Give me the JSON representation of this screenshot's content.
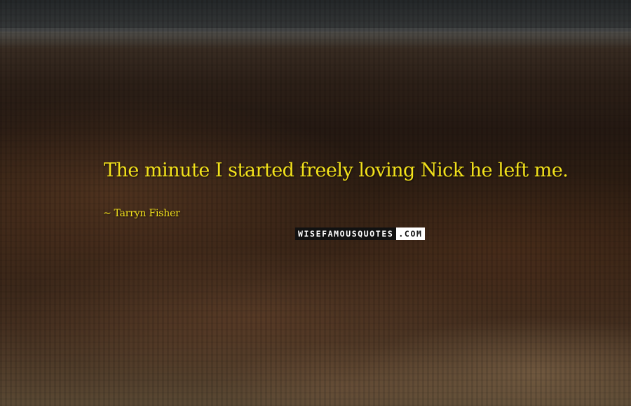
{
  "quote": {
    "text": "The minute I started freely loving Nick he left me.",
    "author_dash": "~",
    "author": "Tarryn Fisher",
    "text_color": "#f2e11b"
  },
  "watermark": {
    "part1": "WISEFAMOUSQUOTES",
    "part2": ".COM"
  }
}
